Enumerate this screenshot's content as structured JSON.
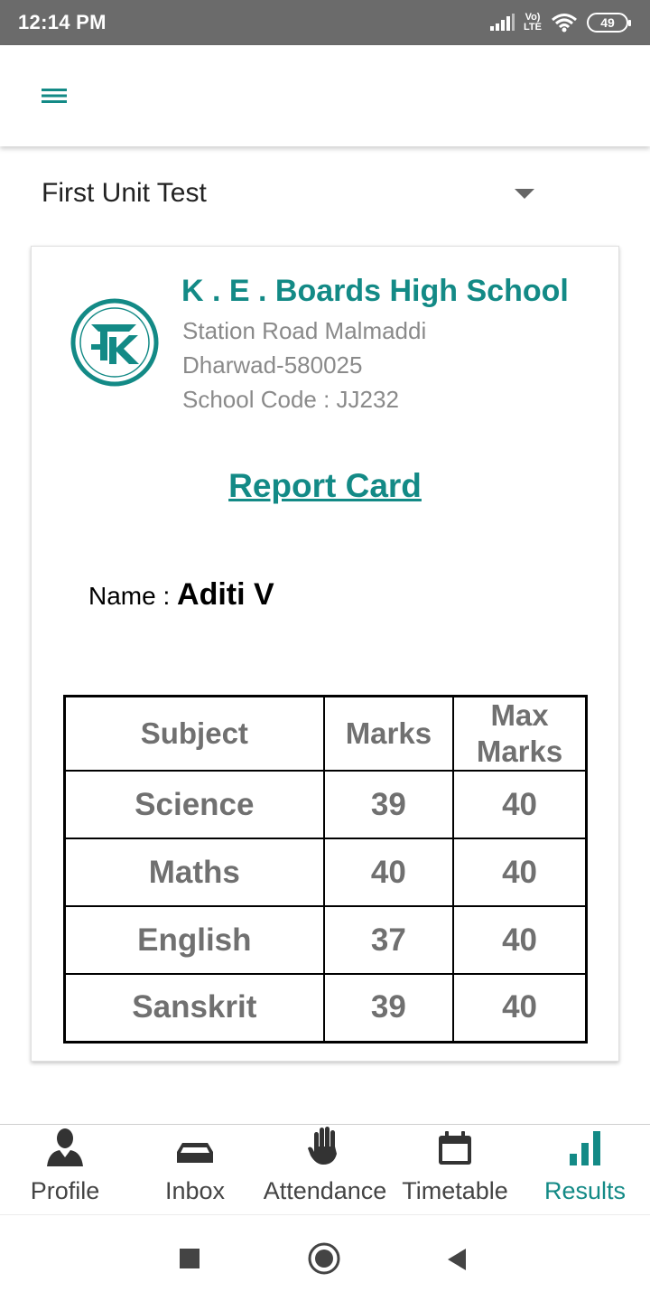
{
  "status_bar": {
    "time": "12:14 PM",
    "network_top": "Vo)",
    "network_bottom": "LTE",
    "battery": "49"
  },
  "app_bar": {
    "menu_icon": "hamburger-menu-icon"
  },
  "exam_selector": {
    "selected": "First Unit Test"
  },
  "school": {
    "name": "K . E . Boards High School",
    "address_line1": "Station Road Malmaddi",
    "address_line2": "Dharwad-580025",
    "code_line": "School Code : JJ232",
    "logo_icon": "school-logo-icon"
  },
  "report": {
    "title": "Report Card",
    "name_label": "Name : ",
    "student_name": "Aditi V"
  },
  "table": {
    "headers": {
      "subject": "Subject",
      "marks": "Marks",
      "max_line1": "Max",
      "max_line2": "Marks"
    },
    "rows": [
      {
        "subject": "Science",
        "marks": "39",
        "max": "40"
      },
      {
        "subject": "Maths",
        "marks": "40",
        "max": "40"
      },
      {
        "subject": "English",
        "marks": "37",
        "max": "40"
      },
      {
        "subject": "Sanskrit",
        "marks": "39",
        "max": "40"
      }
    ]
  },
  "bottom_nav": {
    "items": [
      {
        "label": "Profile",
        "icon": "person-icon"
      },
      {
        "label": "Inbox",
        "icon": "inbox-icon"
      },
      {
        "label": "Attendance",
        "icon": "hand-icon"
      },
      {
        "label": "Timetable",
        "icon": "calendar-icon"
      },
      {
        "label": "Results",
        "icon": "bar-chart-icon",
        "active": true
      }
    ]
  },
  "colors": {
    "accent": "#138a86",
    "status_bar": "#6b6b6b",
    "table_text": "#707070"
  }
}
